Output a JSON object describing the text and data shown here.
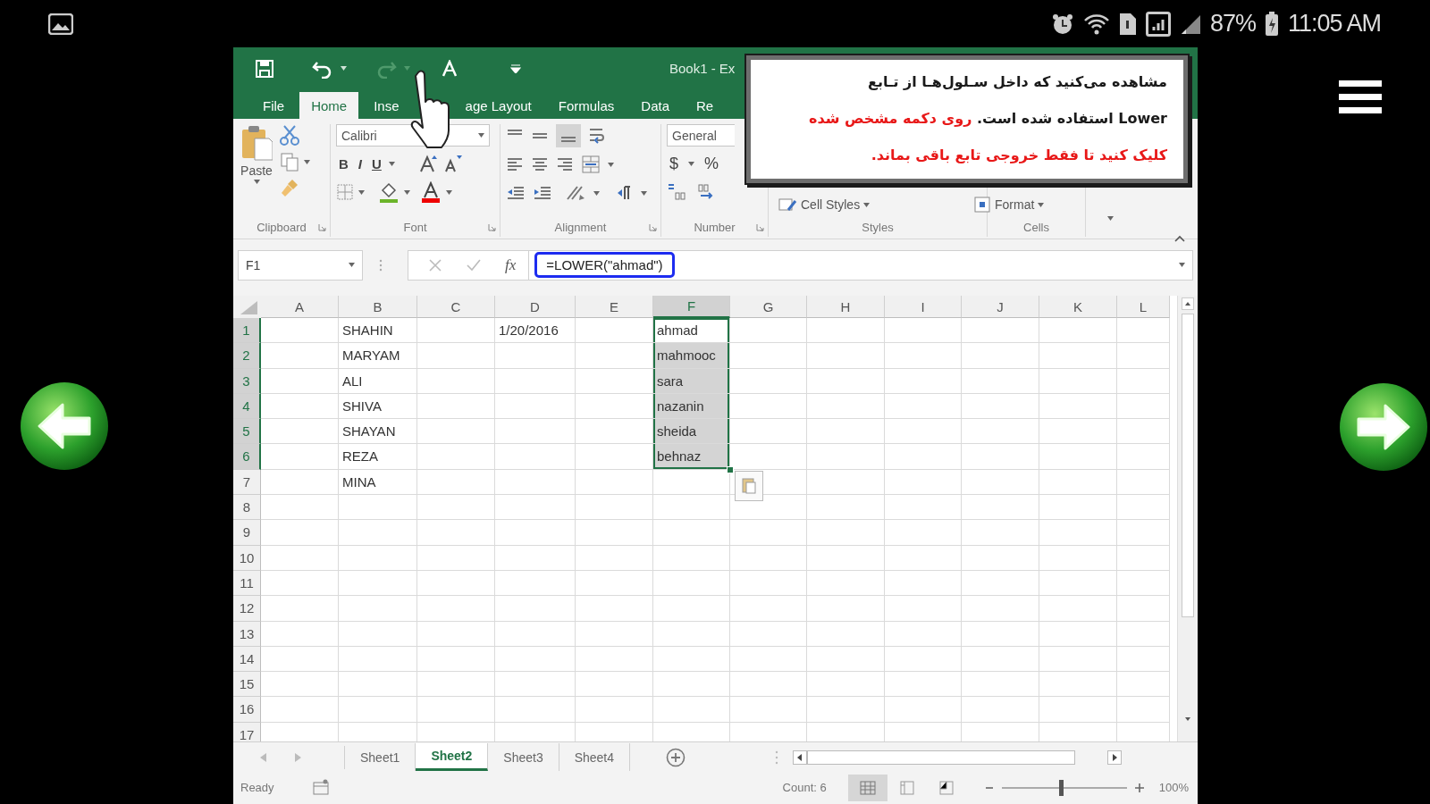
{
  "status_bar": {
    "battery": "87%",
    "time": "11:05 AM"
  },
  "window": {
    "title": "Book1 - Ex"
  },
  "ribbon_tabs": [
    {
      "label": "File",
      "selected": false
    },
    {
      "label": "Home",
      "selected": true
    },
    {
      "label": "Inse",
      "selected": false
    },
    {
      "label": "age Layout",
      "selected": false
    },
    {
      "label": "Formulas",
      "selected": false
    },
    {
      "label": "Data",
      "selected": false
    },
    {
      "label": "Re",
      "selected": false
    }
  ],
  "ribbon": {
    "paste": "Paste",
    "font_name": "Calibri",
    "font_buttons": [
      "B",
      "I",
      "U"
    ],
    "number_format": "General",
    "currency": "$",
    "percent": "%",
    "cell_styles": "Cell Styles",
    "format": "Format",
    "groups": [
      "Clipboard",
      "Font",
      "Alignment",
      "Number",
      "Styles",
      "Cells"
    ]
  },
  "formula_bar": {
    "name_box": "F1",
    "fx": "fx",
    "formula": "=LOWER(\"ahmad\")",
    "highlighted": true
  },
  "grid": {
    "columns": [
      {
        "label": "A",
        "selected": false
      },
      {
        "label": "B",
        "selected": false
      },
      {
        "label": "C",
        "selected": false
      },
      {
        "label": "D",
        "selected": false
      },
      {
        "label": "E",
        "selected": false
      },
      {
        "label": "F",
        "selected": true
      },
      {
        "label": "G",
        "selected": false
      },
      {
        "label": "H",
        "selected": false
      },
      {
        "label": "I",
        "selected": false
      },
      {
        "label": "J",
        "selected": false
      },
      {
        "label": "K",
        "selected": false
      },
      {
        "label": "L",
        "selected": false
      }
    ],
    "rows": [
      {
        "label": "1",
        "selected": true,
        "cells": {
          "B": {
            "text": "SHAHIN",
            "selected": false,
            "active": false
          },
          "D": {
            "text": "1/20/2016",
            "selected": false,
            "active": false
          },
          "F": {
            "text": "ahmad",
            "selected": true,
            "active": true
          }
        }
      },
      {
        "label": "2",
        "selected": true,
        "cells": {
          "B": {
            "text": "MARYAM",
            "selected": false,
            "active": false
          },
          "F": {
            "text": "mahmooc",
            "selected": true,
            "active": false
          }
        }
      },
      {
        "label": "3",
        "selected": true,
        "cells": {
          "B": {
            "text": "ALI",
            "selected": false,
            "active": false
          },
          "F": {
            "text": "sara",
            "selected": true,
            "active": false
          }
        }
      },
      {
        "label": "4",
        "selected": true,
        "cells": {
          "B": {
            "text": "SHIVA",
            "selected": false,
            "active": false
          },
          "F": {
            "text": "nazanin",
            "selected": true,
            "active": false
          }
        }
      },
      {
        "label": "5",
        "selected": true,
        "cells": {
          "B": {
            "text": "SHAYAN",
            "selected": false,
            "active": false
          },
          "F": {
            "text": "sheida",
            "selected": true,
            "active": false
          }
        }
      },
      {
        "label": "6",
        "selected": true,
        "cells": {
          "B": {
            "text": "REZA",
            "selected": false,
            "active": false
          },
          "F": {
            "text": "behnaz",
            "selected": true,
            "active": false
          }
        }
      },
      {
        "label": "7",
        "selected": false,
        "cells": {
          "B": {
            "text": "MINA",
            "selected": false,
            "active": false
          }
        }
      },
      {
        "label": "8",
        "selected": false
      },
      {
        "label": "9",
        "selected": false
      },
      {
        "label": "10",
        "selected": false
      },
      {
        "label": "11",
        "selected": false
      },
      {
        "label": "12",
        "selected": false
      },
      {
        "label": "13",
        "selected": false
      },
      {
        "label": "14",
        "selected": false
      },
      {
        "label": "15",
        "selected": false
      },
      {
        "label": "16",
        "selected": false
      },
      {
        "label": "17",
        "selected": false
      }
    ]
  },
  "sheet_tabs": [
    {
      "label": "Sheet1",
      "selected": false
    },
    {
      "label": "Sheet2",
      "selected": true
    },
    {
      "label": "Sheet3",
      "selected": false
    },
    {
      "label": "Sheet4",
      "selected": false
    }
  ],
  "footer": {
    "mode": "Ready",
    "summary": "Count: 6",
    "zoom": "100%",
    "zoom_slider": {
      "level": 0.47
    },
    "views": [
      {
        "kind": "normal",
        "selected": true
      },
      {
        "kind": "page_layout",
        "selected": false
      },
      {
        "kind": "page_break",
        "selected": false
      }
    ]
  },
  "callout": {
    "lines": [
      [
        {
          "text": "مشاهده می‌کنید که داخل سـلول‌هـا از تـابع",
          "emphasis": false
        }
      ],
      [
        {
          "text": "Lower استفاده شده است.",
          "emphasis": false
        },
        {
          "text": " روی دکمه مشخص شده",
          "emphasis": true
        }
      ],
      [
        {
          "text": "کلیک کنید تا فقط خروجی تابع باقی بماند.",
          "emphasis": true
        }
      ]
    ]
  }
}
